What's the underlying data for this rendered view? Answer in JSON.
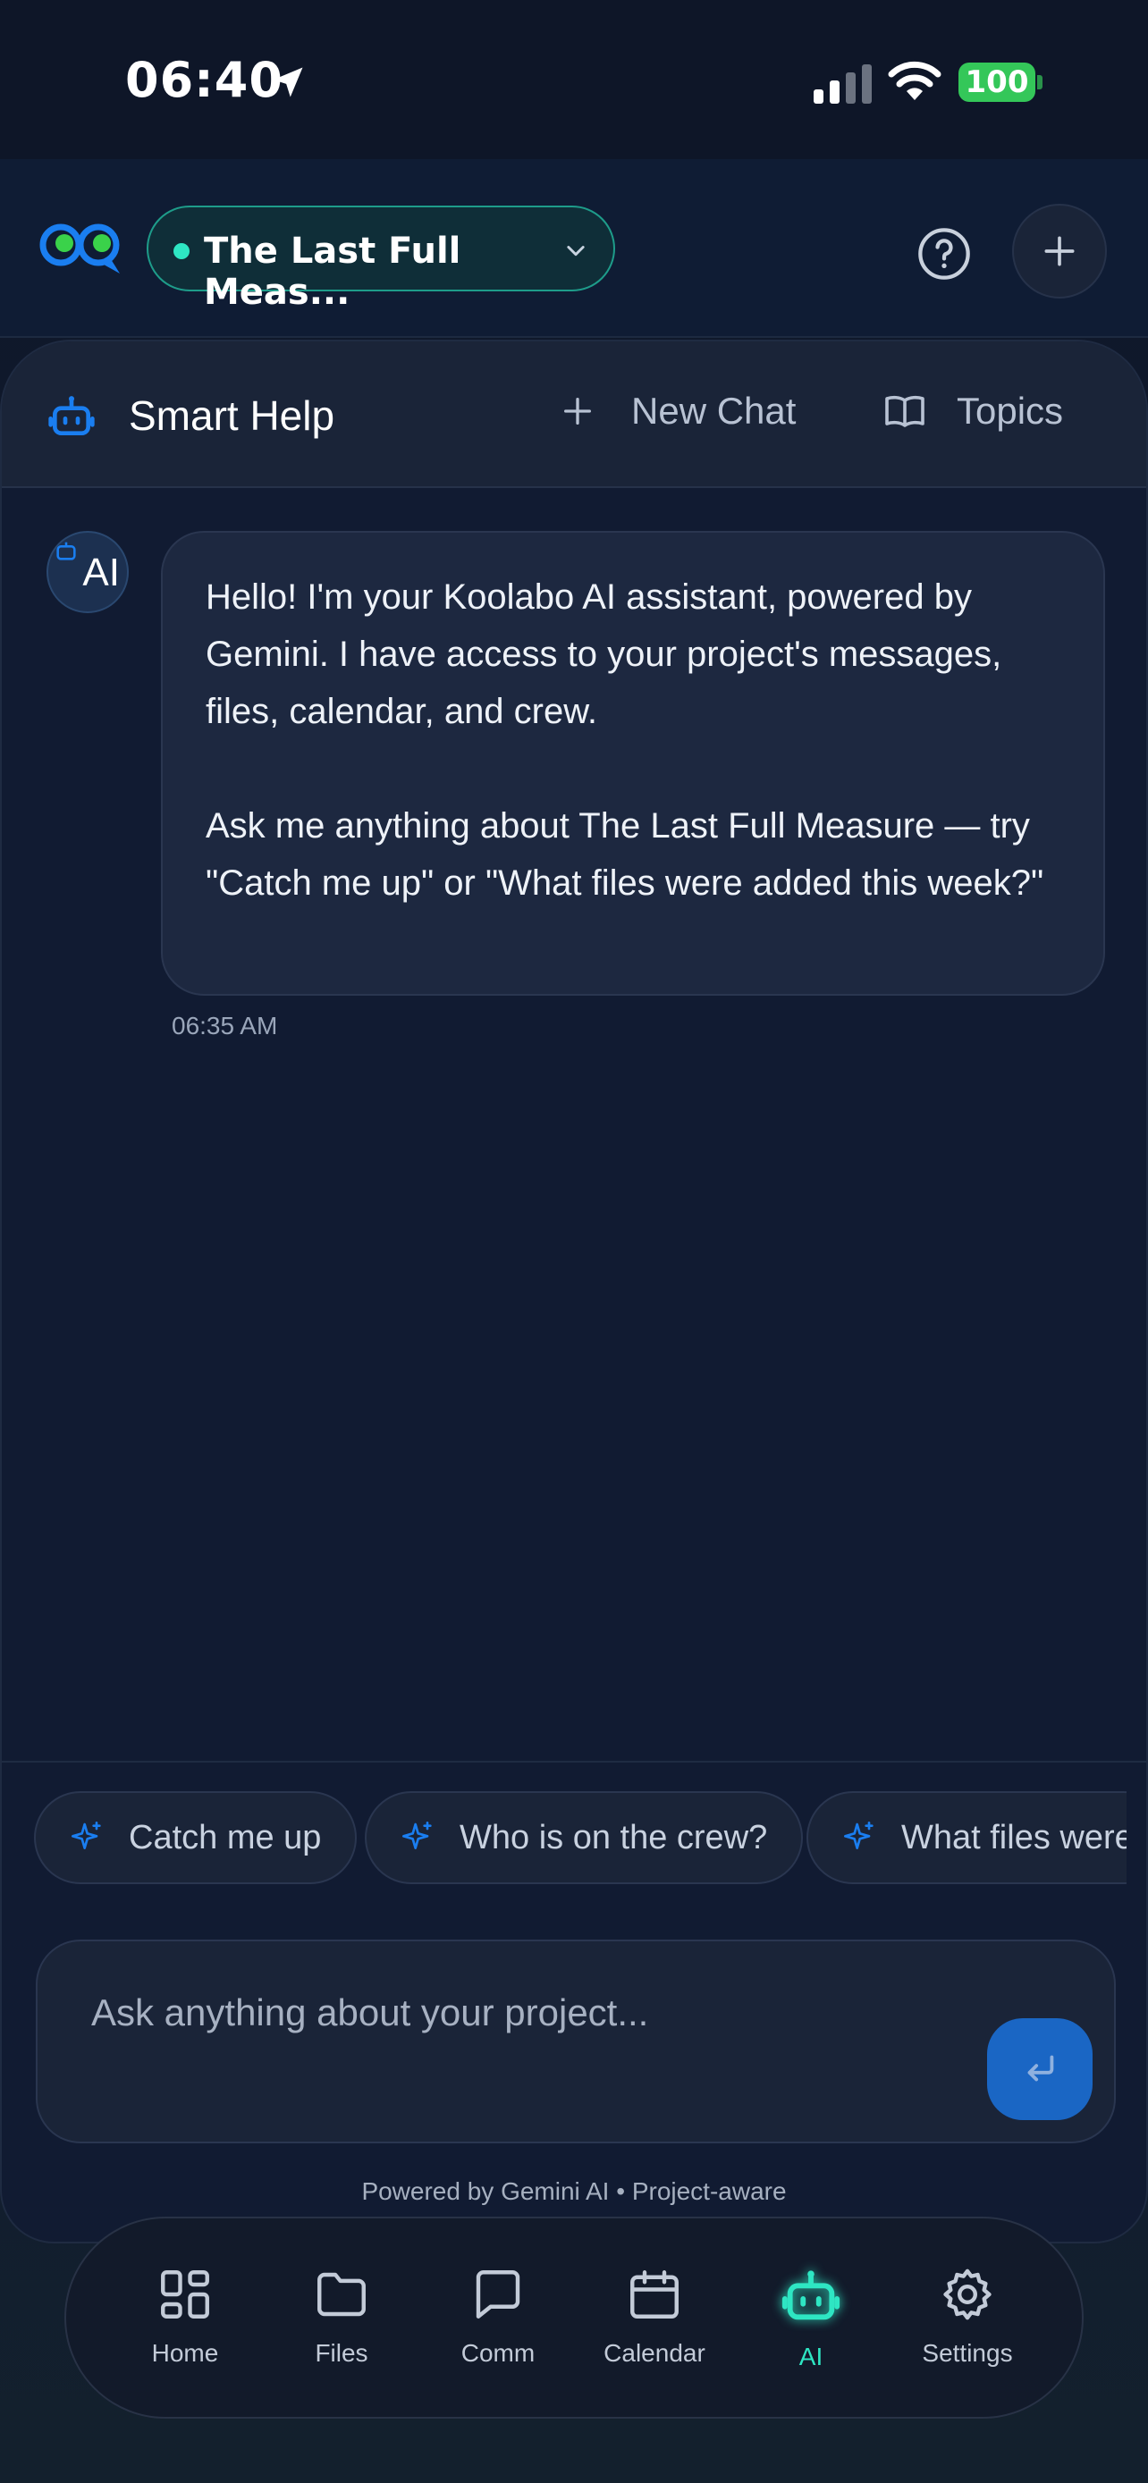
{
  "status_bar": {
    "time": "06:40",
    "battery": "100"
  },
  "header": {
    "project_name": "The Last Full Meas...",
    "help_icon": "question-circle-icon",
    "add_icon": "plus-icon"
  },
  "assistant": {
    "title": "Smart Help",
    "new_chat_label": "New Chat",
    "topics_label": "Topics",
    "avatar_label": "AI",
    "message_paragraph_1": "Hello! I'm your Koolabo AI assistant, powered by Gemini. I have access to your project's messages, files, calendar, and crew.",
    "message_paragraph_2": "Ask me anything about The Last Full Measure — try \"Catch me up\" or \"What files were added this week?\"",
    "message_time": "06:35 AM",
    "suggestions": [
      {
        "label": "Catch me up"
      },
      {
        "label": "Who is on the crew?"
      },
      {
        "label": "What files were"
      }
    ],
    "input_placeholder": "Ask anything about your project...",
    "footer": "Powered by Gemini AI • Project-aware"
  },
  "nav": {
    "items": [
      {
        "label": "Home",
        "icon": "grid-icon"
      },
      {
        "label": "Files",
        "icon": "folder-icon"
      },
      {
        "label": "Comm",
        "icon": "chat-icon"
      },
      {
        "label": "Calendar",
        "icon": "calendar-icon"
      },
      {
        "label": "AI",
        "icon": "robot-icon",
        "active": true
      },
      {
        "label": "Settings",
        "icon": "gear-icon"
      }
    ]
  },
  "colors": {
    "accent_teal": "#2ee6c3",
    "accent_blue": "#1a66c4",
    "background": "#0f1729",
    "battery_green": "#34c759"
  }
}
